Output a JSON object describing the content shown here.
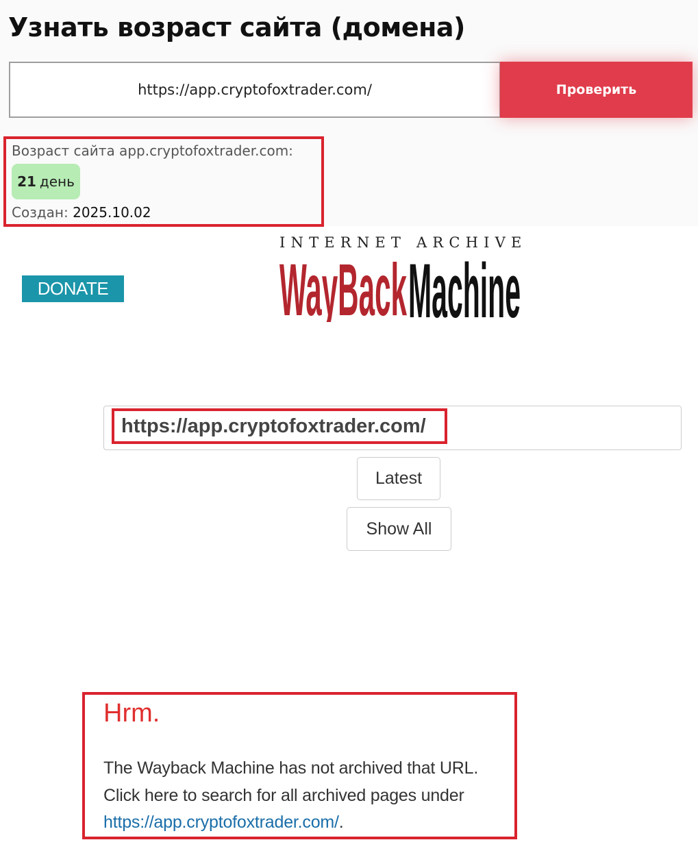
{
  "header": {
    "title": "Узнать возраст сайта (домена)"
  },
  "check_form": {
    "url_value": "https://app.cryptofoxtrader.com/",
    "button_label": "Проверить"
  },
  "result": {
    "age_label": "Возраст сайта app.cryptofoxtrader.com:",
    "age_number": "21",
    "age_unit": "день",
    "created_label": "Создан:",
    "created_value": "2025.10.02",
    "badge_color": "#b7ecb4"
  },
  "wayback": {
    "donate_label": "DONATE",
    "internet_archive_text": "INTERNET ARCHIVE",
    "logo_word_1": "WayBack",
    "logo_word_2": "Machine",
    "search_value": "https://app.cryptofoxtrader.com/",
    "latest_label": "Latest",
    "show_all_label": "Show All",
    "error_title": "Hrm.",
    "error_line1": "The Wayback Machine has not archived that URL.",
    "error_line2": "Click here to search for all archived pages under",
    "error_link": "https://app.cryptofoxtrader.com/",
    "error_link_suffix": "."
  },
  "colors": {
    "accent_red": "#e03c4b",
    "highlight_red": "#d9232e",
    "donate_teal": "#1a95a9",
    "link_blue": "#1a6ea9",
    "logo_red": "#b3262e"
  }
}
